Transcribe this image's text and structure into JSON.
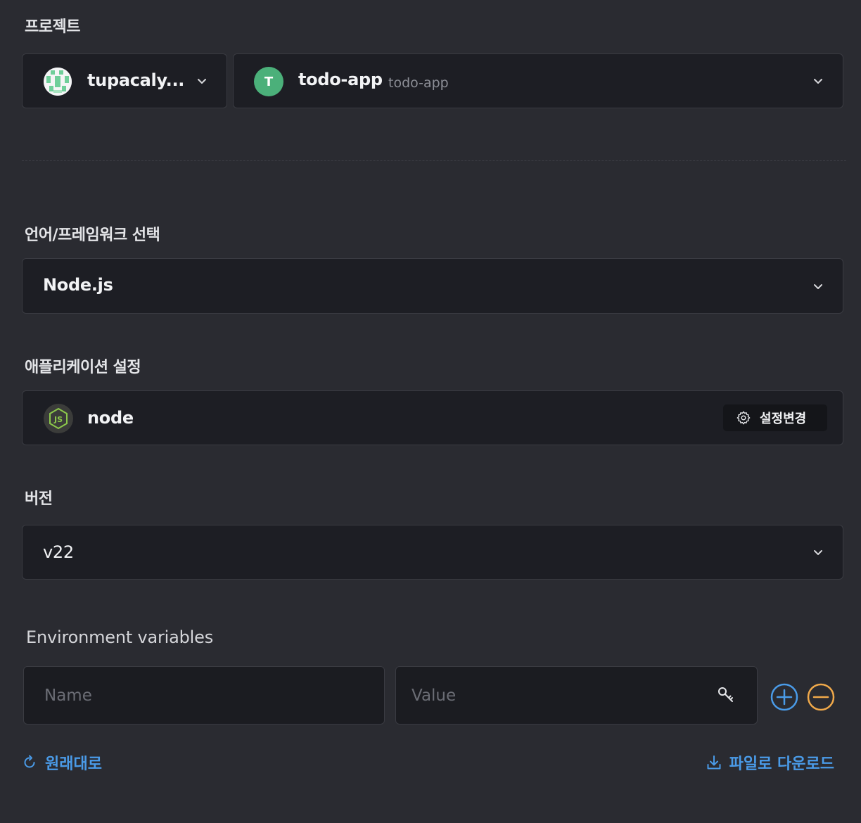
{
  "project": {
    "label": "프로젝트",
    "org_name": "tupacaly...",
    "project_initial": "T",
    "project_name": "todo-app",
    "project_slug": "todo-app"
  },
  "framework": {
    "label": "언어/프레임워크 선택",
    "selected": "Node.js"
  },
  "app_settings": {
    "label": "애플리케이션 설정",
    "app_name": "node",
    "change_button": "설정변경"
  },
  "version": {
    "label": "버전",
    "selected": "v22"
  },
  "env": {
    "label": "Environment variables",
    "name_placeholder": "Name",
    "value_placeholder": "Value"
  },
  "actions": {
    "reset": "원래대로",
    "download": "파일로 다운로드"
  },
  "colors": {
    "background": "#2a2b31",
    "field": "#1d1e24",
    "accent_blue": "#4a9be8",
    "accent_orange": "#f0a94a",
    "avatar_green": "#4bb07a"
  }
}
